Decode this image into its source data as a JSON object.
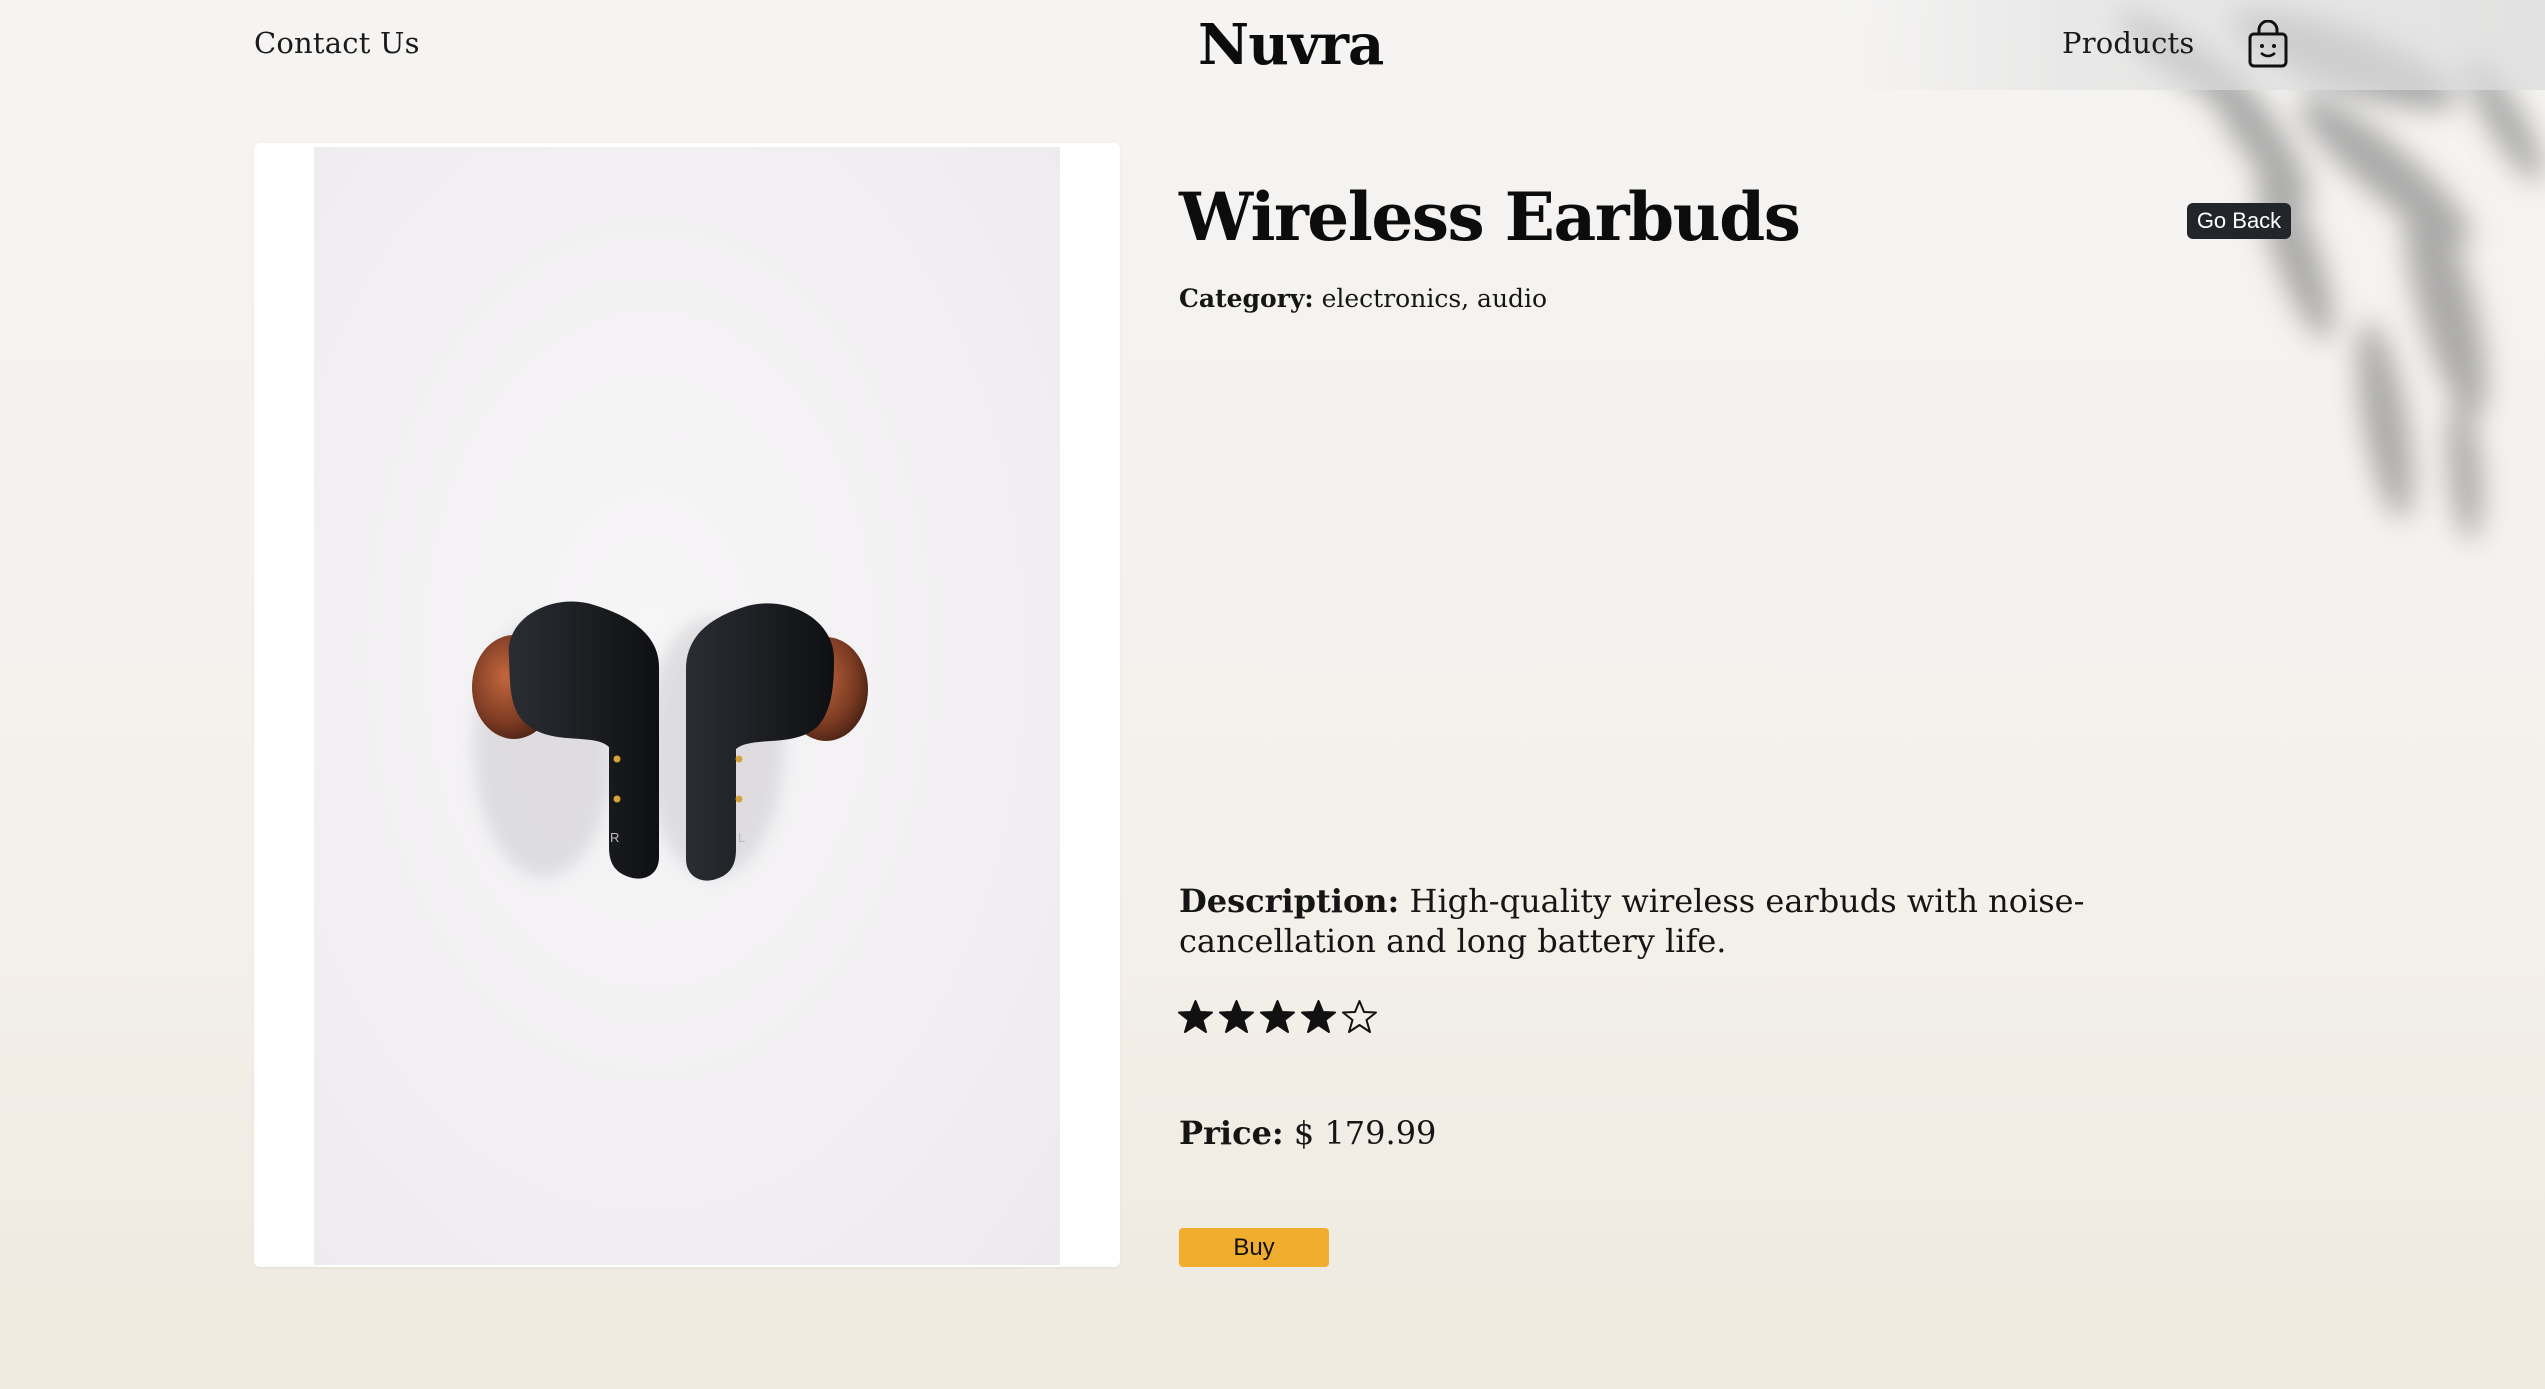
{
  "header": {
    "brand": "Nuvra",
    "contact_label": "Contact Us",
    "products_label": "Products",
    "cart_icon": "shopping-bag-icon"
  },
  "product": {
    "title": "Wireless Earbuds",
    "go_back_label": "Go Back",
    "category_label": "Category:",
    "category_value": "electronics, audio",
    "description_label": "Description:",
    "description_text": "High-quality wireless earbuds with noise-cancellation and long battery life.",
    "rating": {
      "value": 4,
      "max": 5
    },
    "price_label": "Price:",
    "price_value": "$ 179.99",
    "buy_label": "Buy",
    "image_alt_icon": "earbuds-photo"
  },
  "colors": {
    "buy_button": "#f0ad2e",
    "go_back_button": "#22262b",
    "star": "#111111"
  }
}
